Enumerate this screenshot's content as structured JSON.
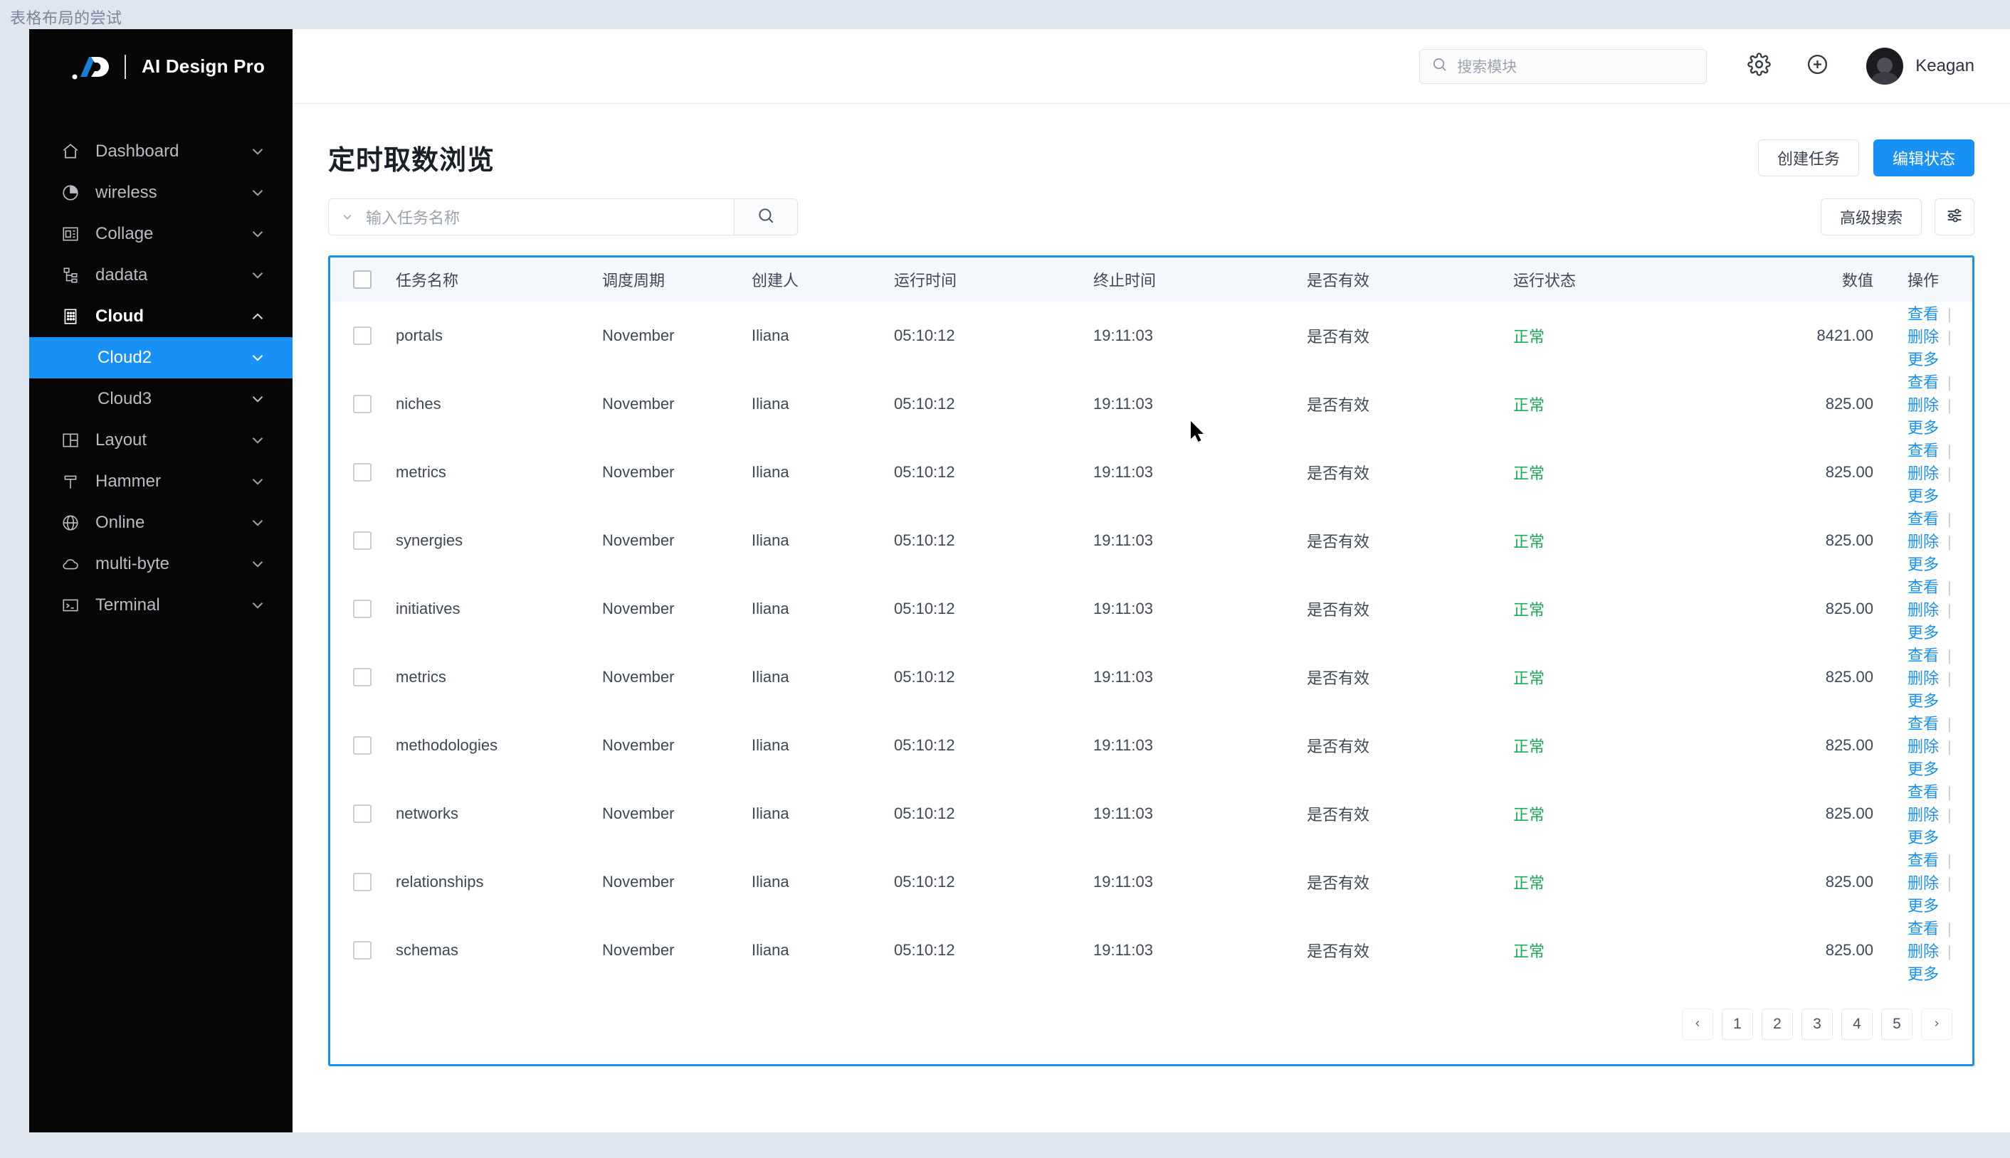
{
  "artboard": {
    "label": "表格布局的尝试"
  },
  "brand": {
    "name": "AI Design Pro",
    "logo_icon": "ai-design-logo"
  },
  "sidebar": {
    "items": [
      {
        "label": "Dashboard",
        "icon": "home-icon",
        "chevron": "chevron-down-icon"
      },
      {
        "label": "wireless",
        "icon": "pie-chart-icon",
        "chevron": "chevron-down-icon"
      },
      {
        "label": "Collage",
        "icon": "layout-panel-icon",
        "chevron": "chevron-down-icon"
      },
      {
        "label": "dadata",
        "icon": "sitemap-icon",
        "chevron": "chevron-down-icon"
      },
      {
        "label": "Cloud",
        "icon": "building-icon",
        "chevron": "chevron-up-icon",
        "expanded": true
      },
      {
        "label": "Layout",
        "icon": "columns-icon",
        "chevron": "chevron-down-icon"
      },
      {
        "label": "Hammer",
        "icon": "hammer-icon",
        "chevron": "chevron-down-icon"
      },
      {
        "label": "Online",
        "icon": "globe-icon",
        "chevron": "chevron-down-icon"
      },
      {
        "label": "multi-byte",
        "icon": "cloud-icon",
        "chevron": "chevron-down-icon"
      },
      {
        "label": "Terminal",
        "icon": "terminal-icon",
        "chevron": "chevron-down-icon"
      }
    ],
    "sub_items": [
      {
        "label": "Cloud2",
        "active": true,
        "chevron": "chevron-down-icon"
      },
      {
        "label": "Cloud3",
        "active": false,
        "chevron": "chevron-down-icon"
      }
    ],
    "active_color": "#1890f5",
    "background": "#060606"
  },
  "topbar": {
    "search": {
      "placeholder": "搜索模块",
      "icon": "search-icon"
    },
    "gear_icon": "gear-icon",
    "add_icon": "plus-circle-icon",
    "user": {
      "name": "Keagan",
      "avatar_icon": "avatar"
    }
  },
  "page": {
    "title": "定时取数浏览",
    "create_task_label": "创建任务",
    "edit_state_label": "编辑状态"
  },
  "filter": {
    "caret_icon": "chevron-down-icon",
    "name_placeholder": "输入任务名称",
    "search_icon": "search-icon",
    "advanced_search_label": "高级搜索",
    "settings_icon": "sliders-icon"
  },
  "table": {
    "columns": [
      {
        "key": "check",
        "label": ""
      },
      {
        "key": "name",
        "label": "任务名称"
      },
      {
        "key": "cycle",
        "label": "调度周期"
      },
      {
        "key": "owner",
        "label": "创建人"
      },
      {
        "key": "run",
        "label": "运行时间"
      },
      {
        "key": "end",
        "label": "终止时间"
      },
      {
        "key": "valid",
        "label": "是否有效"
      },
      {
        "key": "state",
        "label": "运行状态"
      },
      {
        "key": "num",
        "label": "数值"
      },
      {
        "key": "ops",
        "label": "操作"
      }
    ],
    "ops": {
      "view": "查看",
      "delete": "删除",
      "more": "更多",
      "separator": "|"
    },
    "state_color": "#18a957",
    "rows": [
      {
        "name": "portals",
        "cycle": "November",
        "owner": "Iliana",
        "run": "05:10:12",
        "end": "19:11:03",
        "valid": "是否有效",
        "state": "正常",
        "num": "8421.00"
      },
      {
        "name": "niches",
        "cycle": "November",
        "owner": "Iliana",
        "run": "05:10:12",
        "end": "19:11:03",
        "valid": "是否有效",
        "state": "正常",
        "num": "825.00"
      },
      {
        "name": "metrics",
        "cycle": "November",
        "owner": "Iliana",
        "run": "05:10:12",
        "end": "19:11:03",
        "valid": "是否有效",
        "state": "正常",
        "num": "825.00"
      },
      {
        "name": "synergies",
        "cycle": "November",
        "owner": "Iliana",
        "run": "05:10:12",
        "end": "19:11:03",
        "valid": "是否有效",
        "state": "正常",
        "num": "825.00"
      },
      {
        "name": "initiatives",
        "cycle": "November",
        "owner": "Iliana",
        "run": "05:10:12",
        "end": "19:11:03",
        "valid": "是否有效",
        "state": "正常",
        "num": "825.00"
      },
      {
        "name": "metrics",
        "cycle": "November",
        "owner": "Iliana",
        "run": "05:10:12",
        "end": "19:11:03",
        "valid": "是否有效",
        "state": "正常",
        "num": "825.00"
      },
      {
        "name": "methodologies",
        "cycle": "November",
        "owner": "Iliana",
        "run": "05:10:12",
        "end": "19:11:03",
        "valid": "是否有效",
        "state": "正常",
        "num": "825.00"
      },
      {
        "name": "networks",
        "cycle": "November",
        "owner": "Iliana",
        "run": "05:10:12",
        "end": "19:11:03",
        "valid": "是否有效",
        "state": "正常",
        "num": "825.00"
      },
      {
        "name": "relationships",
        "cycle": "November",
        "owner": "Iliana",
        "run": "05:10:12",
        "end": "19:11:03",
        "valid": "是否有效",
        "state": "正常",
        "num": "825.00"
      },
      {
        "name": "schemas",
        "cycle": "November",
        "owner": "Iliana",
        "run": "05:10:12",
        "end": "19:11:03",
        "valid": "是否有效",
        "state": "正常",
        "num": "825.00"
      }
    ]
  },
  "pagination": {
    "prev_icon": "chevron-left-icon",
    "next_icon": "chevron-right-icon",
    "pages": [
      "1",
      "2",
      "3",
      "4",
      "5"
    ],
    "current": "1"
  }
}
